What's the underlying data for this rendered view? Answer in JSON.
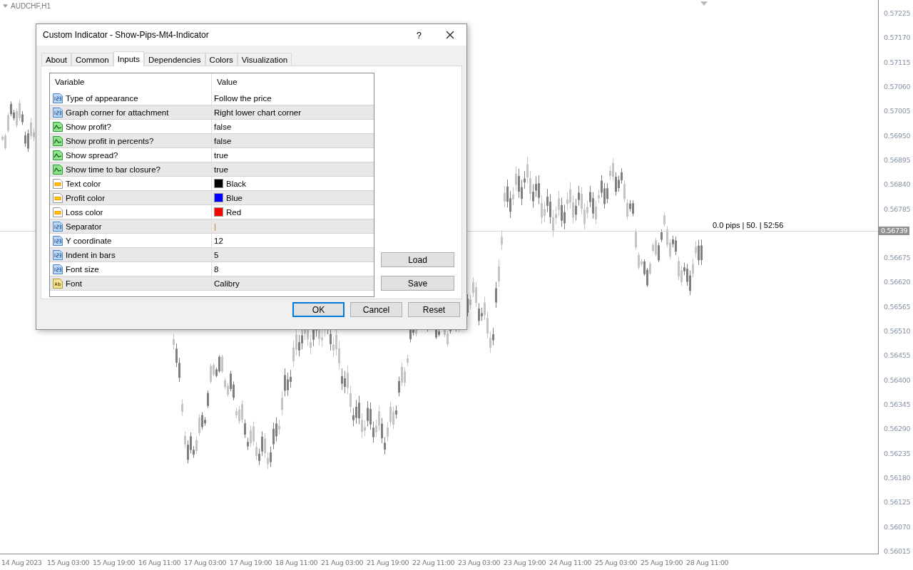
{
  "chart": {
    "symbol": "AUDCHF,H1",
    "overlay_text": "0.0 pips | 50. | 52:56",
    "price_axis": [
      "0.57225",
      "0.57170",
      "0.57115",
      "0.57060",
      "0.57005",
      "0.56950",
      "0.56895",
      "0.56840",
      "0.56785",
      {
        "kind": "current",
        "label": "0.56739"
      },
      "0.56675",
      "0.56620",
      "0.56565",
      "0.56510",
      "0.56455",
      "0.56400",
      "0.56345",
      "0.56290",
      "0.56235",
      "0.56180",
      "0.56125",
      "0.56070",
      "0.56015"
    ],
    "time_axis": [
      "14 Aug 2023",
      "15 Aug 03:00",
      "15 Aug 19:00",
      "16 Aug 11:00",
      "17 Aug 03:00",
      "17 Aug 19:00",
      "18 Aug 11:00",
      "21 Aug 03:00",
      "21 Aug 19:00",
      "22 Aug 11:00",
      "23 Aug 03:00",
      "23 Aug 19:00",
      "24 Aug 11:00",
      "25 Aug 03:00",
      "25 Aug 19:00",
      "28 Aug 11:00"
    ]
  },
  "dialog": {
    "title": "Custom Indicator - Show-Pips-Mt4-Indicator",
    "help": "?",
    "tabs": [
      {
        "label": "About",
        "selected": false
      },
      {
        "label": "Common",
        "selected": false
      },
      {
        "label": "Inputs",
        "selected": true
      },
      {
        "label": "Dependencies",
        "selected": false
      },
      {
        "label": "Colors",
        "selected": false
      },
      {
        "label": "Visualization",
        "selected": false
      }
    ],
    "table": {
      "columns": [
        "Variable",
        "Value"
      ],
      "rows": [
        {
          "kind": "number",
          "variable": "Type of appearance",
          "value": "Follow the price"
        },
        {
          "kind": "number",
          "variable": "Graph corner for attachment",
          "value": "Right lower chart corner"
        },
        {
          "kind": "bool",
          "variable": "Show profit?",
          "value": "false"
        },
        {
          "kind": "bool",
          "variable": "Show profit in percents?",
          "value": "false"
        },
        {
          "kind": "bool",
          "variable": "Show spread?",
          "value": "true"
        },
        {
          "kind": "bool",
          "variable": "Show time to bar closure?",
          "value": "true"
        },
        {
          "kind": "color",
          "variable": "Text color",
          "value": "Black",
          "color": "#000000"
        },
        {
          "kind": "color",
          "variable": "Profit color",
          "value": "Blue",
          "color": "#0000ff"
        },
        {
          "kind": "color",
          "variable": "Loss color",
          "value": "Red",
          "color": "#ff0000"
        },
        {
          "kind": "number",
          "variable": "Separator",
          "value": "|"
        },
        {
          "kind": "number",
          "variable": "Y coordinate",
          "value": "12"
        },
        {
          "kind": "number",
          "variable": "Indent in bars",
          "value": "5"
        },
        {
          "kind": "number",
          "variable": "Font size",
          "value": "8"
        },
        {
          "kind": "string",
          "variable": "Font",
          "value": "Calibry"
        }
      ]
    },
    "side_buttons": [
      "Load",
      "Save"
    ],
    "buttons": [
      {
        "label": "OK",
        "default": true
      },
      {
        "label": "Cancel",
        "default": false
      },
      {
        "label": "Reset",
        "default": false
      }
    ]
  }
}
